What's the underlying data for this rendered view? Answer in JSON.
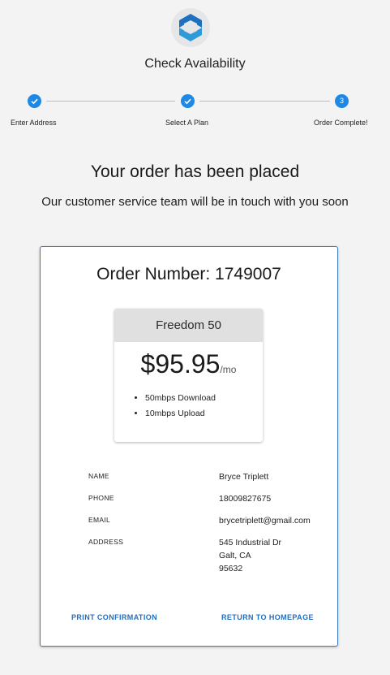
{
  "header": {
    "title": "Check Availability"
  },
  "stepper": {
    "steps": [
      {
        "label": "Enter Address",
        "status": "complete"
      },
      {
        "label": "Select A Plan",
        "status": "complete"
      },
      {
        "label": "Order Complete!",
        "status": "active",
        "number": "3"
      }
    ]
  },
  "confirmation": {
    "headline": "Your order has been placed",
    "subline": "Our customer service team will be in touch with you soon"
  },
  "order": {
    "number_label": "Order Number: 1749007",
    "plan": {
      "name": "Freedom 50",
      "price": "$95.95",
      "unit": "/mo",
      "features": [
        "50mbps Download",
        "10mbps Upload"
      ]
    },
    "details": {
      "name_label": "NAME",
      "name_value": "Bryce Triplett",
      "phone_label": "PHONE",
      "phone_value": "18009827675",
      "email_label": "EMAIL",
      "email_value": "brycetriplett@gmail.com",
      "address_label": "ADDRESS",
      "address_line1": "545 Industrial Dr",
      "address_line2": "Galt, CA",
      "address_line3": "95632"
    },
    "actions": {
      "print_label": "PRINT CONFIRMATION",
      "home_label": "RETURN TO HOMEPAGE"
    }
  },
  "colors": {
    "accent": "#1e88e5",
    "link": "#1e6fc6",
    "card_border": "#3f7fbf",
    "plan_header_bg": "#e0e0e0",
    "page_bg": "#f3f3f3"
  }
}
